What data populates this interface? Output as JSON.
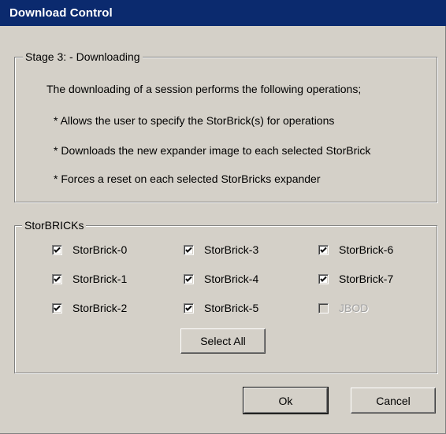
{
  "window": {
    "title": "Download Control"
  },
  "stage": {
    "legend": "Stage 3: - Downloading",
    "intro": "The downloading of a session performs the following operations;",
    "bullets": [
      "*  Allows the user to specify the StorBrick(s) for operations",
      "*  Downloads the new expander image to each selected StorBrick",
      "*  Forces a reset on each selected StorBricks expander"
    ]
  },
  "storbricks": {
    "legend": "StorBRICKs",
    "items": [
      {
        "label": "StorBrick-0",
        "checked": true,
        "enabled": true
      },
      {
        "label": "StorBrick-1",
        "checked": true,
        "enabled": true
      },
      {
        "label": "StorBrick-2",
        "checked": true,
        "enabled": true
      },
      {
        "label": "StorBrick-3",
        "checked": true,
        "enabled": true
      },
      {
        "label": "StorBrick-4",
        "checked": true,
        "enabled": true
      },
      {
        "label": "StorBrick-5",
        "checked": true,
        "enabled": true
      },
      {
        "label": "StorBrick-6",
        "checked": true,
        "enabled": true
      },
      {
        "label": "StorBrick-7",
        "checked": true,
        "enabled": true
      },
      {
        "label": "JBOD",
        "checked": false,
        "enabled": false
      }
    ],
    "select_all_label": "Select All"
  },
  "buttons": {
    "ok_label": "Ok",
    "cancel_label": "Cancel"
  }
}
